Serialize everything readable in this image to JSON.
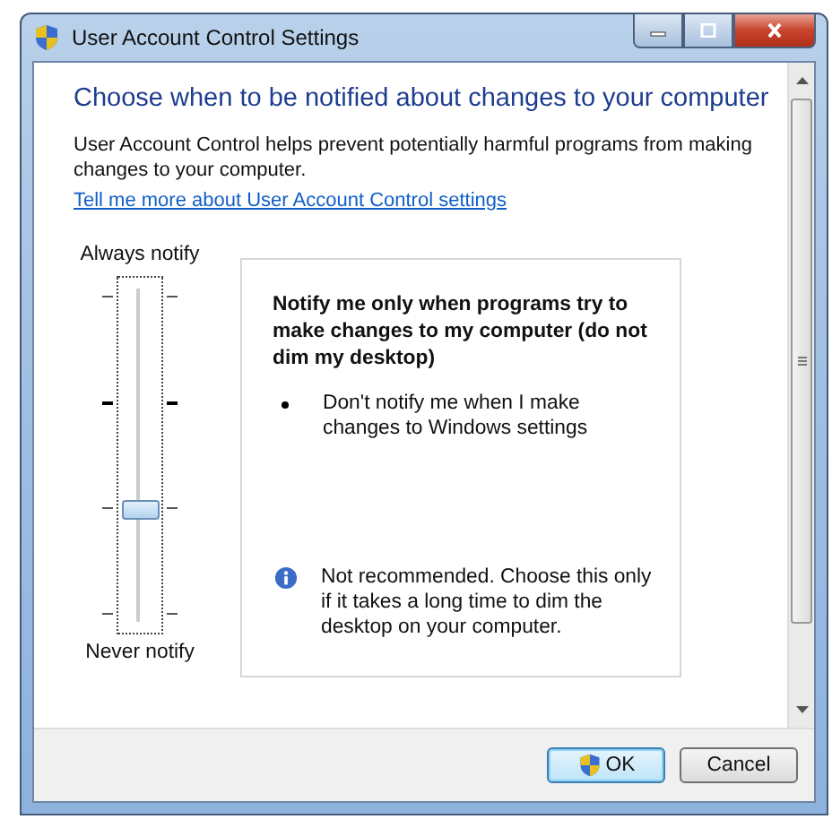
{
  "window": {
    "title": "User Account Control Settings"
  },
  "heading": "Choose when to be notified about changes to your computer",
  "description": "User Account Control helps prevent potentially harmful programs from making changes to your computer.",
  "link": "Tell me more about User Account Control settings",
  "slider": {
    "top_label": "Always notify",
    "bottom_label": "Never notify",
    "level": 0.33
  },
  "info_panel": {
    "title": "Notify me only when programs try to make changes to my computer (do not dim my desktop)",
    "bullets": [
      "Don't notify me when I make changes to Windows settings"
    ],
    "note": "Not recommended. Choose this only if it takes a long time to dim the desktop on your computer."
  },
  "buttons": [
    {
      "label": "OK",
      "kind": "shield"
    },
    {
      "label": "Cancel",
      "kind": "plain"
    }
  ]
}
